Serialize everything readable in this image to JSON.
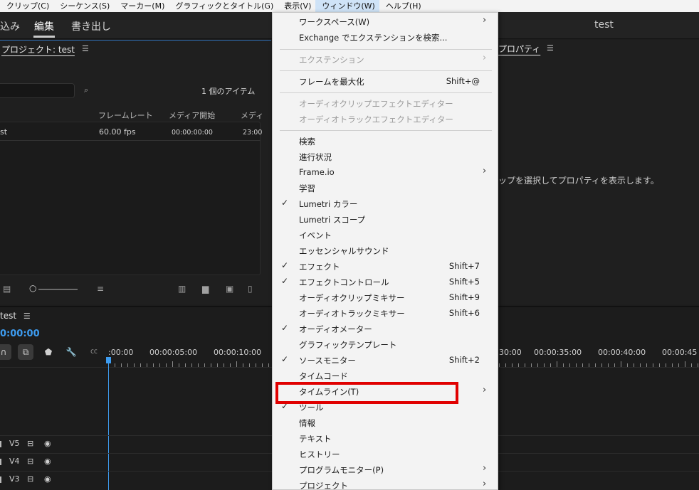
{
  "menubar": {
    "items": [
      "クリップ(C)",
      "シーケンス(S)",
      "マーカー(M)",
      "グラフィックとタイトル(G)",
      "表示(V)",
      "ウィンドウ(W)",
      "ヘルプ(H)"
    ]
  },
  "workspace": {
    "tabs": [
      "込み",
      "編集",
      "書き出し"
    ],
    "sequence_title": "test"
  },
  "project_panel": {
    "title": "プロジェクト: test",
    "item_count": "1 個のアイテム",
    "columns": [
      "フレームレート",
      "メディア開始",
      "メディ"
    ],
    "row": {
      "name": "st",
      "framerate": "60.00 fps",
      "media_start": "00:00:00:00",
      "media_end": "23:00"
    }
  },
  "props_panel": {
    "title": "プロパティ",
    "message": "ップを選択してプロパティを表示します。"
  },
  "timeline": {
    "title": "test",
    "timecode": "0:00:00",
    "ruler_labels": [
      ":00:00",
      "00:00:05:00",
      "00:00:10:00",
      "30:00",
      "00:00:35:00",
      "00:00:40:00",
      "00:00:45"
    ],
    "tracks": [
      "V5",
      "V4",
      "V3"
    ]
  },
  "menu": {
    "items": [
      {
        "label": "ワークスペース(W)",
        "submenu": true
      },
      {
        "label": "Exchange でエクステンションを検索..."
      },
      {
        "label": "エクステンション",
        "submenu": true,
        "disabled": true
      },
      {
        "label": "フレームを最大化",
        "shortcut": "Shift+@"
      },
      {
        "label": "オーディオクリップエフェクトエディター",
        "disabled": true
      },
      {
        "label": "オーディオトラックエフェクトエディター",
        "disabled": true
      },
      {
        "label": "検索"
      },
      {
        "label": "進行状況"
      },
      {
        "label": "Frame.io",
        "submenu": true
      },
      {
        "label": "学習"
      },
      {
        "label": "Lumetri カラー",
        "checked": true
      },
      {
        "label": "Lumetri スコープ"
      },
      {
        "label": "イベント"
      },
      {
        "label": "エッセンシャルサウンド"
      },
      {
        "label": "エフェクト",
        "checked": true,
        "shortcut": "Shift+7"
      },
      {
        "label": "エフェクトコントロール",
        "checked": true,
        "shortcut": "Shift+5"
      },
      {
        "label": "オーディオクリップミキサー",
        "shortcut": "Shift+9"
      },
      {
        "label": "オーディオトラックミキサー",
        "shortcut": "Shift+6"
      },
      {
        "label": "オーディオメーター",
        "checked": true
      },
      {
        "label": "グラフィックテンプレート"
      },
      {
        "label": "ソースモニター",
        "checked": true,
        "shortcut": "Shift+2"
      },
      {
        "label": "タイムコード"
      },
      {
        "label": "タイムライン(T)",
        "submenu": true
      },
      {
        "label": "ツール",
        "checked": true
      },
      {
        "label": "情報"
      },
      {
        "label": "テキスト"
      },
      {
        "label": "ヒストリー"
      },
      {
        "label": "プログラムモニター(P)",
        "submenu": true
      },
      {
        "label": "プロジェクト",
        "submenu": true
      }
    ]
  },
  "colors": {
    "accent_blue": "#3d9cf0",
    "highlight_red": "#e00000"
  }
}
